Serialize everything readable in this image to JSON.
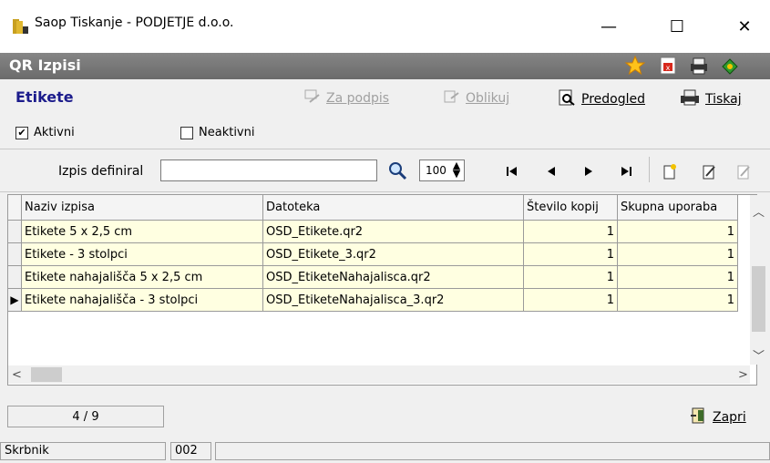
{
  "window": {
    "title": "Saop Tiskanje - PODJETJE d.o.o.",
    "minimize": "—",
    "maximize": "☐",
    "close": "✕"
  },
  "header": {
    "title": "QR Izpisi",
    "icons": [
      "star-icon",
      "close-report-icon",
      "printer-stack-icon",
      "export-icon"
    ]
  },
  "toolbar": {
    "section_title": "Etikete",
    "za_podpis": "Za podpis",
    "oblikuj": "Oblikuj",
    "predogled": "Predogled",
    "tiskaj": "Tiskaj"
  },
  "filters": {
    "aktivni_label": "Aktivni",
    "aktivni_checked": "✔",
    "neaktivni_label": "Neaktivni"
  },
  "search": {
    "label": "Izpis definiral",
    "value": "",
    "zoom": "100"
  },
  "table": {
    "columns": [
      "Naziv izpisa",
      "Datoteka",
      "Število kopij",
      "Skupna uporaba"
    ],
    "rows": [
      {
        "indicator": "",
        "naziv": "Etikete 5 x 2,5 cm",
        "datoteka": "OSD_Etikete.qr2",
        "kopij": "1",
        "skupna": "1"
      },
      {
        "indicator": "",
        "naziv": "Etikete - 3 stolpci",
        "datoteka": "OSD_Etikete_3.qr2",
        "kopij": "1",
        "skupna": "1"
      },
      {
        "indicator": "",
        "naziv": "Etikete nahajališča 5 x 2,5 cm",
        "datoteka": "OSD_EtiketeNahajalisca.qr2",
        "kopij": "1",
        "skupna": "1"
      },
      {
        "indicator": "▶",
        "naziv": "Etikete nahajališča - 3 stolpci",
        "datoteka": "OSD_EtiketeNahajalisca_3.qr2",
        "kopij": "1",
        "skupna": "1"
      }
    ]
  },
  "footer": {
    "record_counter": "4 / 9",
    "close_label": "Zapri"
  },
  "statusbar": {
    "user": "Skrbnik",
    "code": "002",
    "extra": ""
  },
  "colors": {
    "header_band": "#6b6b6b",
    "section_title": "#1c1c8c",
    "row_background": "#ffffe1"
  }
}
